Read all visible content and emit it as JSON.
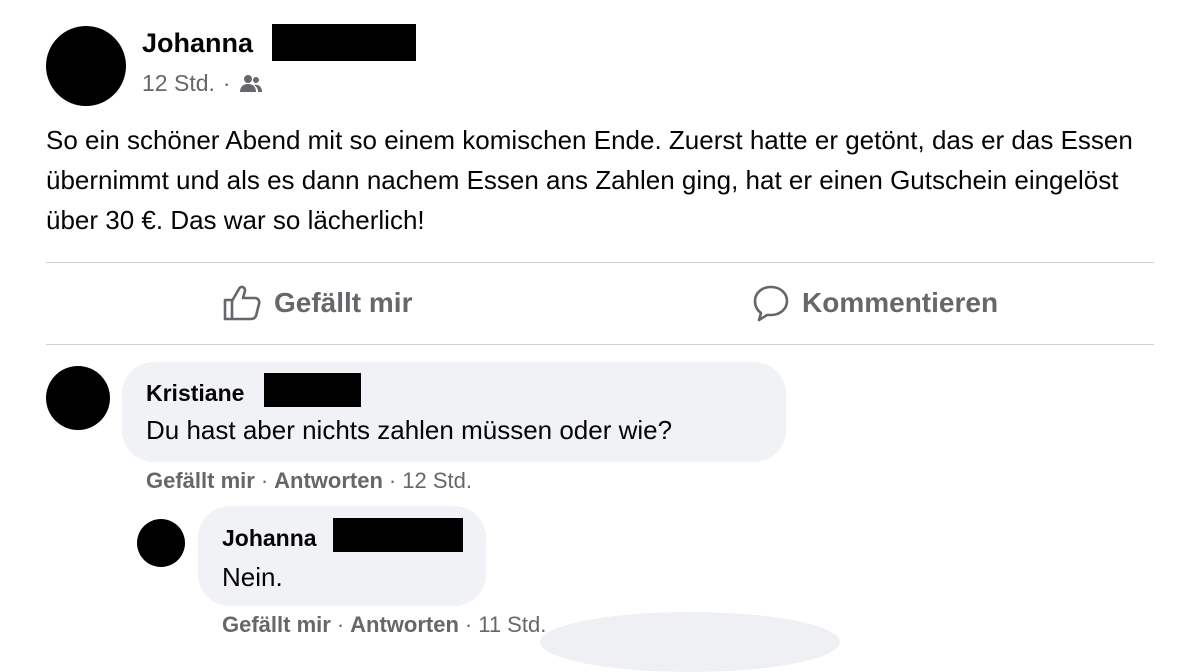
{
  "post": {
    "author": "Johanna",
    "time": "12 Std.",
    "separator": "·",
    "audience_icon": "friends-icon",
    "text": "So ein schöner Abend mit so einem komischen Ende. Zuerst hatte er getönt, das er das Essen übernimmt und als es dann nachem Essen ans Zahlen ging, hat er einen Gutschein eingelöst über 30 €. Das war so lächerlich!"
  },
  "actions": {
    "like_label": "Gefällt mir",
    "like_icon": "thumbs-up-icon",
    "comment_label": "Kommentieren",
    "comment_icon": "comment-bubble-icon"
  },
  "comments": [
    {
      "author": "Kristiane",
      "text": "Du hast aber nichts zahlen müssen oder wie?",
      "like": "Gefällt mir",
      "reply": "Antworten",
      "time": "12 Std."
    },
    {
      "author": "Johanna",
      "text": "Nein.",
      "like": "Gefällt mir",
      "reply": "Antworten",
      "time": "11 Std."
    }
  ],
  "colors": {
    "text": "#050505",
    "secondary": "#65676b",
    "bubble": "#f0f2f5",
    "divider": "#ced0d4",
    "redaction": "#000000"
  }
}
